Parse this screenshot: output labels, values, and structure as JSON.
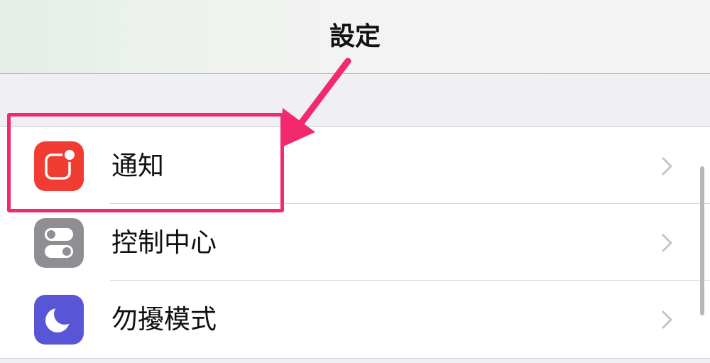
{
  "navbar": {
    "title": "設定"
  },
  "settings_list": {
    "items": [
      {
        "label": "通知",
        "icon": "notification-icon",
        "icon_color": "#f03c32"
      },
      {
        "label": "控制中心",
        "icon": "control-center-icon",
        "icon_color": "#8e8e93"
      },
      {
        "label": "勿擾模式",
        "icon": "moon-icon",
        "icon_color": "#5856d6"
      }
    ]
  },
  "annotation": {
    "highlight_color": "#f2296d",
    "highlight_target": "notifications-row",
    "arrow_icon": "arrow-icon"
  }
}
